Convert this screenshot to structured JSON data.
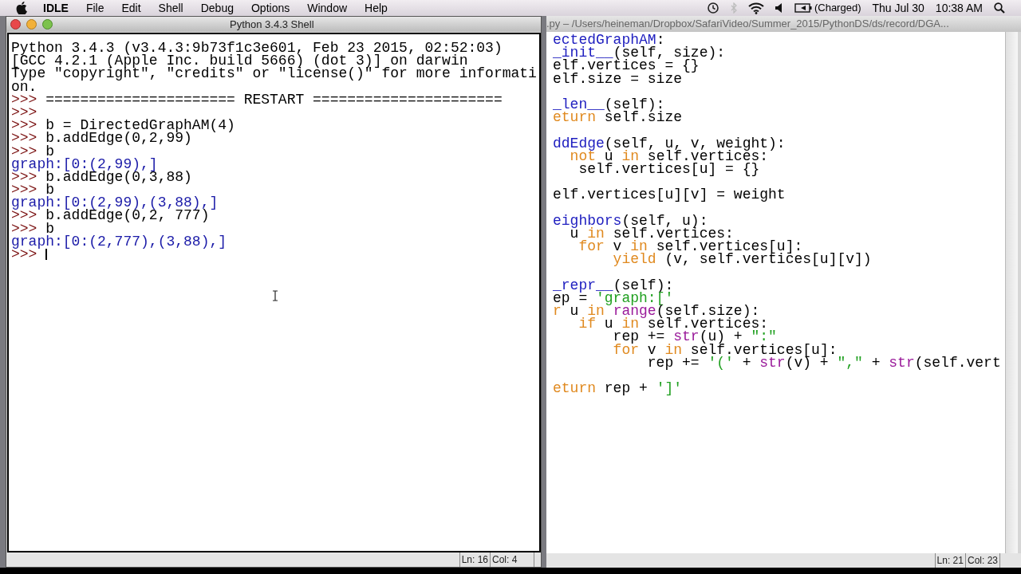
{
  "menu_bar": {
    "app_name": "IDLE",
    "items": [
      "File",
      "Edit",
      "Shell",
      "Debug",
      "Options",
      "Window",
      "Help"
    ],
    "battery_status": "(Charged)",
    "date": "Thu Jul 30",
    "time": "10:38 AM"
  },
  "shell_window": {
    "title": "Python 3.4.3 Shell",
    "lines": [
      {
        "kind": "banner",
        "text": "Python 3.4.3 (v3.4.3:9b73f1c3e601, Feb 23 2015, 02:52:03)"
      },
      {
        "kind": "banner",
        "text": "[GCC 4.2.1 (Apple Inc. build 5666) (dot 3)] on darwin"
      },
      {
        "kind": "banner",
        "text": "Type \"copyright\", \"credits\" or \"license()\" for more informati"
      },
      {
        "kind": "banner",
        "text": "on."
      },
      {
        "kind": "input",
        "prompt": ">>>",
        "text": "====================== RESTART ======================"
      },
      {
        "kind": "input",
        "prompt": ">>>"
      },
      {
        "kind": "input",
        "prompt": ">>>",
        "text": "b = DirectedGraphAM(4)"
      },
      {
        "kind": "input",
        "prompt": ">>>",
        "text": "b.addEdge(0,2,99)"
      },
      {
        "kind": "input",
        "prompt": ">>>",
        "text": "b"
      },
      {
        "kind": "output",
        "text": "graph:[0:(2,99),]"
      },
      {
        "kind": "input",
        "prompt": ">>>",
        "text": "b.addEdge(0,3,88)"
      },
      {
        "kind": "input",
        "prompt": ">>>",
        "text": "b"
      },
      {
        "kind": "output",
        "text": "graph:[0:(2,99),(3,88),]"
      },
      {
        "kind": "input",
        "prompt": ">>>",
        "text": "b.addEdge(0,2, 777)"
      },
      {
        "kind": "input",
        "prompt": ">>>",
        "text": "b"
      },
      {
        "kind": "output",
        "text": "graph:[0:(2,777),(3,88),]"
      },
      {
        "kind": "input",
        "prompt": ">>>",
        "caret": true
      }
    ],
    "status": {
      "line": "Ln: 16",
      "column": "Col: 4"
    }
  },
  "editor_window": {
    "title": ".py – /Users/heineman/Dropbox/SafariVideo/Summer_2015/PythonDS/ds/record/DGA...",
    "lines": [
      {
        "kind": "code",
        "tokens": [
          {
            "kind": "name",
            "text": "ectedGraphAM"
          },
          {
            "kind": "plain",
            "text": ":"
          }
        ]
      },
      {
        "kind": "code",
        "tokens": [
          {
            "kind": "name",
            "text": "_init__"
          },
          {
            "kind": "plain",
            "text": "(self, size):"
          }
        ]
      },
      {
        "kind": "code",
        "tokens": [
          {
            "kind": "plain",
            "text": "elf.vertices = {}"
          }
        ]
      },
      {
        "kind": "code",
        "tokens": [
          {
            "kind": "plain",
            "text": "elf.size = size"
          }
        ]
      },
      {
        "kind": "blank"
      },
      {
        "kind": "code",
        "tokens": [
          {
            "kind": "name",
            "text": "_len__"
          },
          {
            "kind": "plain",
            "text": "(self):"
          }
        ]
      },
      {
        "kind": "code",
        "tokens": [
          {
            "kind": "keyword",
            "text": "eturn"
          },
          {
            "kind": "plain",
            "text": " self.size"
          }
        ]
      },
      {
        "kind": "blank"
      },
      {
        "kind": "code",
        "tokens": [
          {
            "kind": "name",
            "text": "ddEdge"
          },
          {
            "kind": "plain",
            "text": "(self, u, v, weight):"
          }
        ]
      },
      {
        "kind": "code",
        "tokens": [
          {
            "kind": "keyword",
            "text": "  not"
          },
          {
            "kind": "plain",
            "text": " u "
          },
          {
            "kind": "keyword",
            "text": "in"
          },
          {
            "kind": "plain",
            "text": " self.vertices:"
          }
        ]
      },
      {
        "kind": "code",
        "tokens": [
          {
            "kind": "plain",
            "text": "   self.vertices[u] = {}"
          }
        ]
      },
      {
        "kind": "blank"
      },
      {
        "kind": "code",
        "tokens": [
          {
            "kind": "plain",
            "text": "elf.vertices[u][v] = weight"
          }
        ]
      },
      {
        "kind": "blank"
      },
      {
        "kind": "code",
        "tokens": [
          {
            "kind": "name",
            "text": "eighbors"
          },
          {
            "kind": "plain",
            "text": "(self, u):"
          }
        ]
      },
      {
        "kind": "code",
        "tokens": [
          {
            "kind": "plain",
            "text": "  u "
          },
          {
            "kind": "keyword",
            "text": "in"
          },
          {
            "kind": "plain",
            "text": " self.vertices:"
          }
        ]
      },
      {
        "kind": "code",
        "tokens": [
          {
            "kind": "keyword",
            "text": "   for"
          },
          {
            "kind": "plain",
            "text": " v "
          },
          {
            "kind": "keyword",
            "text": "in"
          },
          {
            "kind": "plain",
            "text": " self.vertices[u]:"
          }
        ]
      },
      {
        "kind": "code",
        "tokens": [
          {
            "kind": "keyword",
            "text": "       yield"
          },
          {
            "kind": "plain",
            "text": " (v, self.vertices[u][v])"
          }
        ]
      },
      {
        "kind": "blank"
      },
      {
        "kind": "code",
        "tokens": [
          {
            "kind": "name",
            "text": "_repr__"
          },
          {
            "kind": "plain",
            "text": "(self):"
          }
        ]
      },
      {
        "kind": "code",
        "tokens": [
          {
            "kind": "plain",
            "text": "ep = "
          },
          {
            "kind": "string",
            "text": "'graph:['"
          }
        ]
      },
      {
        "kind": "code",
        "tokens": [
          {
            "kind": "keyword",
            "text": "r"
          },
          {
            "kind": "plain",
            "text": " u "
          },
          {
            "kind": "keyword",
            "text": "in"
          },
          {
            "kind": "builtin",
            "text": " range"
          },
          {
            "kind": "plain",
            "text": "(self.size):"
          }
        ]
      },
      {
        "kind": "code",
        "tokens": [
          {
            "kind": "keyword",
            "text": "   if"
          },
          {
            "kind": "plain",
            "text": " u "
          },
          {
            "kind": "keyword",
            "text": "in"
          },
          {
            "kind": "plain",
            "text": " self.vertices:"
          }
        ]
      },
      {
        "kind": "code",
        "tokens": [
          {
            "kind": "plain",
            "text": "       rep += "
          },
          {
            "kind": "builtin",
            "text": "str"
          },
          {
            "kind": "plain",
            "text": "(u) + "
          },
          {
            "kind": "string",
            "text": "\":\""
          }
        ]
      },
      {
        "kind": "code",
        "tokens": [
          {
            "kind": "keyword",
            "text": "       for"
          },
          {
            "kind": "plain",
            "text": " v "
          },
          {
            "kind": "keyword",
            "text": "in"
          },
          {
            "kind": "plain",
            "text": " self.vertices[u]:"
          }
        ]
      },
      {
        "kind": "code",
        "tokens": [
          {
            "kind": "plain",
            "text": "           rep += "
          },
          {
            "kind": "string",
            "text": "'('"
          },
          {
            "kind": "plain",
            "text": " + "
          },
          {
            "kind": "builtin",
            "text": "str"
          },
          {
            "kind": "plain",
            "text": "(v) + "
          },
          {
            "kind": "string",
            "text": "\",\""
          },
          {
            "kind": "plain",
            "text": " + "
          },
          {
            "kind": "builtin",
            "text": "str"
          },
          {
            "kind": "plain",
            "text": "(self.vert"
          }
        ]
      },
      {
        "kind": "blank"
      },
      {
        "kind": "code",
        "tokens": [
          {
            "kind": "keyword",
            "text": "eturn"
          },
          {
            "kind": "plain",
            "text": " rep + "
          },
          {
            "kind": "string",
            "text": "']'"
          }
        ]
      }
    ],
    "status": {
      "line": "Ln: 21",
      "column": "Col: 23"
    }
  }
}
